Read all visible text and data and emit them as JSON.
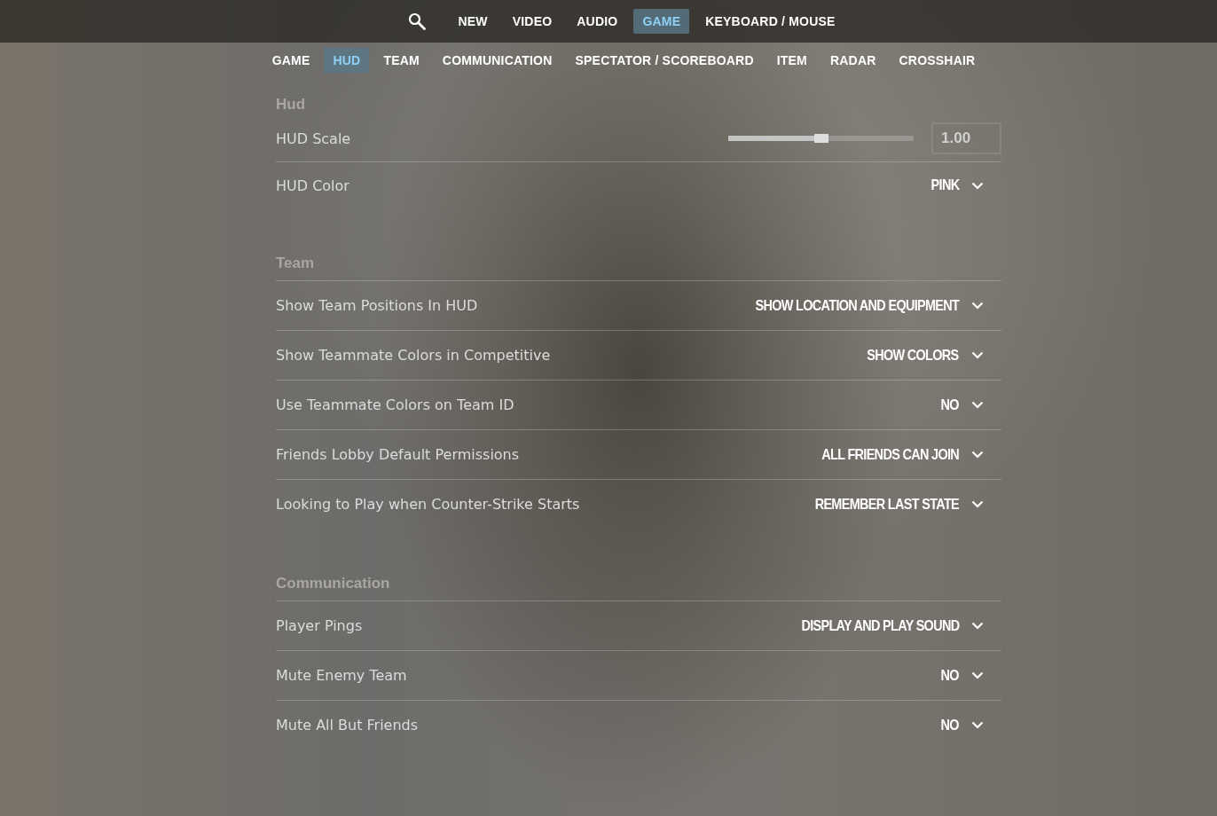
{
  "top_nav": {
    "tabs": [
      {
        "label": "NEW",
        "selected": false
      },
      {
        "label": "VIDEO",
        "selected": false
      },
      {
        "label": "AUDIO",
        "selected": false
      },
      {
        "label": "GAME",
        "selected": true
      },
      {
        "label": "KEYBOARD / MOUSE",
        "selected": false
      }
    ]
  },
  "sub_nav": {
    "tabs": [
      {
        "label": "GAME",
        "selected": false
      },
      {
        "label": "HUD",
        "selected": true
      },
      {
        "label": "TEAM",
        "selected": false
      },
      {
        "label": "COMMUNICATION",
        "selected": false
      },
      {
        "label": "SPECTATOR / SCOREBOARD",
        "selected": false
      },
      {
        "label": "ITEM",
        "selected": false
      },
      {
        "label": "RADAR",
        "selected": false
      },
      {
        "label": "CROSSHAIR",
        "selected": false
      }
    ]
  },
  "sections": [
    {
      "title": "Hud",
      "settings": [
        {
          "kind": "slider",
          "label": "HUD Scale",
          "level": 0.5,
          "value": "1.00"
        },
        {
          "kind": "dropdown",
          "label": "HUD Color",
          "value": "PINK"
        }
      ]
    },
    {
      "title": "Team",
      "settings": [
        {
          "kind": "dropdown",
          "label": "Show Team Positions In HUD",
          "value": "SHOW LOCATION AND EQUIPMENT"
        },
        {
          "kind": "dropdown",
          "label": "Show Teammate Colors in Competitive",
          "value": "SHOW COLORS"
        },
        {
          "kind": "dropdown",
          "label": "Use Teammate Colors on Team ID",
          "value": "NO"
        },
        {
          "kind": "dropdown",
          "label": "Friends Lobby Default Permissions",
          "value": "ALL FRIENDS CAN JOIN"
        },
        {
          "kind": "dropdown",
          "label": "Looking to Play when Counter-Strike Starts",
          "value": "REMEMBER LAST STATE"
        }
      ]
    },
    {
      "title": "Communication",
      "settings": [
        {
          "kind": "dropdown",
          "label": "Player Pings",
          "value": "DISPLAY AND PLAY SOUND"
        },
        {
          "kind": "dropdown",
          "label": "Mute Enemy Team",
          "value": "NO"
        },
        {
          "kind": "dropdown",
          "label": "Mute All But Friends",
          "value": "NO"
        }
      ]
    }
  ]
}
